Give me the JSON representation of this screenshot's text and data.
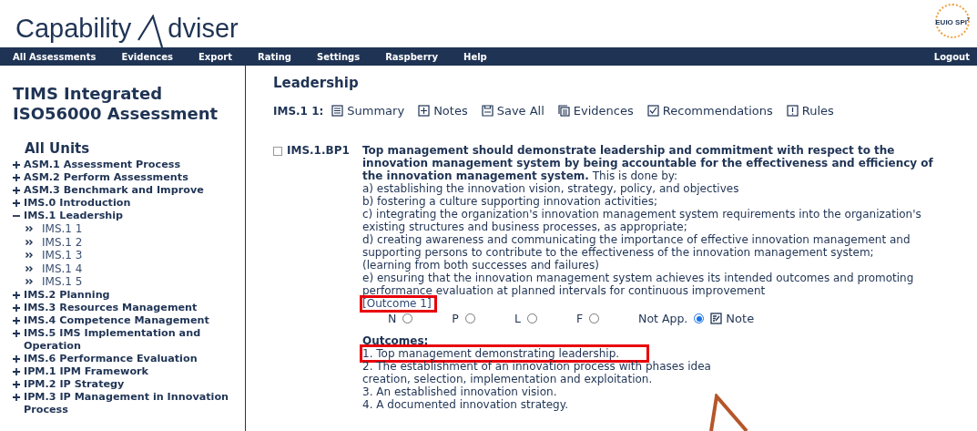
{
  "logo": {
    "before": "Capability",
    "after": "dviser"
  },
  "partner_logo": {
    "text": "EUIO SPI",
    "mark": "2"
  },
  "nav": {
    "items": [
      "All Assessments",
      "Evidences",
      "Export",
      "Rating",
      "Settings",
      "Raspberry",
      "Help"
    ],
    "logout": "Logout"
  },
  "sidebar": {
    "title": "TIMS Integrated ISO56000 Assessment",
    "units_heading": "All Units",
    "items": [
      {
        "label": "ASM.1 Assessment Process",
        "expanded": false
      },
      {
        "label": "ASM.2 Perform Assessments",
        "expanded": false
      },
      {
        "label": "ASM.3 Benchmark and Improve",
        "expanded": false
      },
      {
        "label": "IMS.0 Introduction",
        "expanded": false
      },
      {
        "label": "IMS.1 Leadership",
        "expanded": true,
        "children": [
          "IMS.1 1",
          "IMS.1 2",
          "IMS.1 3",
          "IMS.1 4",
          "IMS.1 5"
        ]
      },
      {
        "label": "IMS.2 Planning",
        "expanded": false
      },
      {
        "label": "IMS.3 Resources Management",
        "expanded": false
      },
      {
        "label": "IMS.4 Competence Management",
        "expanded": false
      },
      {
        "label": "IMS.5 IMS Implementation and Operation",
        "expanded": false
      },
      {
        "label": "IMS.6 Performance Evaluation",
        "expanded": false
      },
      {
        "label": "IPM.1 IPM Framework",
        "expanded": false
      },
      {
        "label": "IPM.2 IP Strategy",
        "expanded": false
      },
      {
        "label": "IPM.3 IP Management in Innovation Process",
        "expanded": false
      }
    ]
  },
  "main": {
    "title": "Leadership",
    "toolbar_label": "IMS.1 1:",
    "tools": [
      {
        "kind": "summary",
        "label": "Summary"
      },
      {
        "kind": "notes",
        "label": "Notes"
      },
      {
        "kind": "save",
        "label": "Save All"
      },
      {
        "kind": "evidences",
        "label": "Evidences"
      },
      {
        "kind": "recommendations",
        "label": "Recommendations"
      },
      {
        "kind": "rules",
        "label": "Rules"
      }
    ],
    "practice": {
      "id": "IMS.1.BP1",
      "checked": false,
      "statement": "**Top management should demonstrate leadership and commitment with respect to the innovation management system by being accountable for the effectiveness and efficiency of the innovation management system.** This is done by:",
      "lines": [
        "a) establishing the innovation vision, strategy, policy, and objectives",
        "b) fostering a culture supporting innovation activities;",
        "c) integrating the organization's innovation management system requirements into the organization's existing structures and business processes, as appropriate;",
        "d) creating awareness and communicating the importance of effective innovation management and supporting persons to contribute to the effectiveness of the innovation management system;",
        "(learning from both successes and failures)",
        "e) ensuring that the innovation management system achieves its intended outcomes and promoting performance evaluation at planned intervals for continuous improvement"
      ],
      "outcome_ref": "[Outcome 1]",
      "ratings": [
        {
          "label": "N",
          "selected": false
        },
        {
          "label": "P",
          "selected": false
        },
        {
          "label": "L",
          "selected": false
        },
        {
          "label": "F",
          "selected": false
        },
        {
          "label": "Not App.",
          "selected": true
        }
      ],
      "note_label": "Note"
    },
    "outcomes": {
      "title": "Outcomes:",
      "items": [
        "1. Top management demonstrating leadership.",
        "2. The establishment of an innovation process with phases idea creation, selection, implementation and exploitation.",
        "3. An established innovation vision.",
        "4. A documented innovation strategy."
      ]
    }
  }
}
